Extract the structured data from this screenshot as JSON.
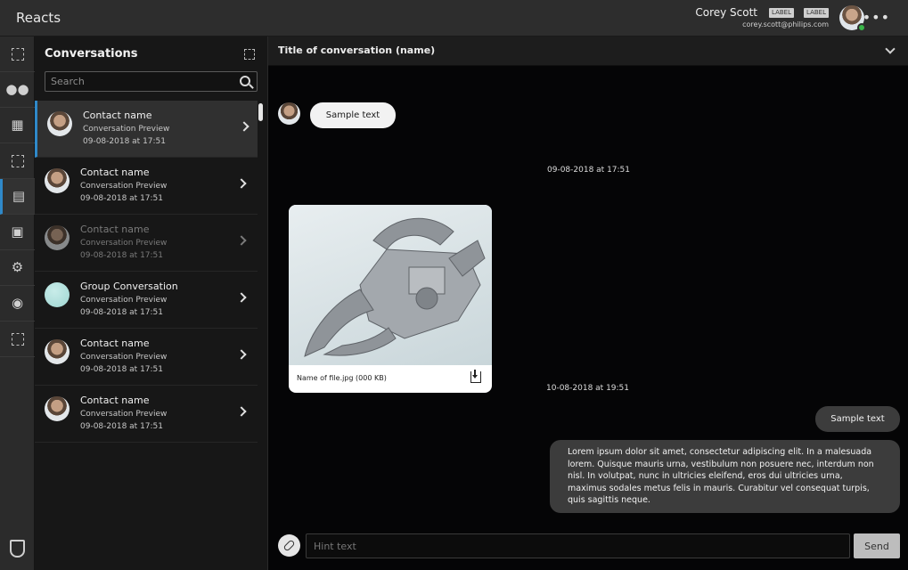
{
  "app": {
    "title": "Reacts"
  },
  "user": {
    "name": "Corey Scott",
    "email": "corey.scott@philips.com",
    "badges": [
      "LABEL",
      "LABEL"
    ],
    "status": "online",
    "status_color": "#39b54a"
  },
  "rail": {
    "items": [
      {
        "icon": "placeholder-icon",
        "glyph": ""
      },
      {
        "icon": "people-icon",
        "glyph": "👥"
      },
      {
        "icon": "calendar-icon",
        "glyph": "▦"
      },
      {
        "icon": "placeholder-icon",
        "glyph": ""
      },
      {
        "icon": "chat-icon",
        "glyph": "▤",
        "active": true
      },
      {
        "icon": "presentation-icon",
        "glyph": "▣"
      },
      {
        "icon": "gear-icon",
        "glyph": "⚙"
      },
      {
        "icon": "user-circle-icon",
        "glyph": "◉"
      },
      {
        "icon": "placeholder-icon",
        "glyph": ""
      }
    ],
    "logo": "philips-shield-icon"
  },
  "conversations": {
    "title": "Conversations",
    "search_placeholder": "Search",
    "items": [
      {
        "name": "Contact name",
        "preview": "Conversation Preview",
        "time": "09-08-2018 at 17:51",
        "active": true
      },
      {
        "name": "Contact name",
        "preview": "Conversation Preview",
        "time": "09-08-2018 at 17:51"
      },
      {
        "name": "Contact name",
        "preview": "Conversation Preview",
        "time": "09-08-2018 at 17:51",
        "muted": true
      },
      {
        "name": "Group Conversation",
        "preview": "Conversation Preview",
        "time": "09-08-2018 at 17:51",
        "group": true
      },
      {
        "name": "Contact name",
        "preview": "Conversation Preview",
        "time": "09-08-2018 at 17:51"
      },
      {
        "name": "Contact name",
        "preview": "Conversation Preview",
        "time": "09-08-2018 at 17:51"
      }
    ]
  },
  "chat": {
    "title": "Title of conversation (name)",
    "incoming_message": "Sample text",
    "timestamp_1": "09-08-2018 at 17:51",
    "file": {
      "name": "Name of file.jpg (000 KB)"
    },
    "timestamp_2": "10-08-2018 at 19:51",
    "outgoing_short": "Sample text",
    "outgoing_long": "Lorem ipsum dolor sit amet, consectetur adipiscing elit. In a malesuada lorem. Quisque mauris urna, vestibulum non posuere nec, interdum non nisl. In volutpat, nunc in ultricies eleifend, eros dui ultricies urna, maximus sodales metus felis in mauris. Curabitur vel consequat turpis, quis sagittis neque.",
    "composer_placeholder": "Hint text",
    "send_label": "Send"
  },
  "colors": {
    "accent": "#2f89c9",
    "background": "#0a0a0c",
    "topbar": "#2d2d2d",
    "panel": "#171717"
  }
}
